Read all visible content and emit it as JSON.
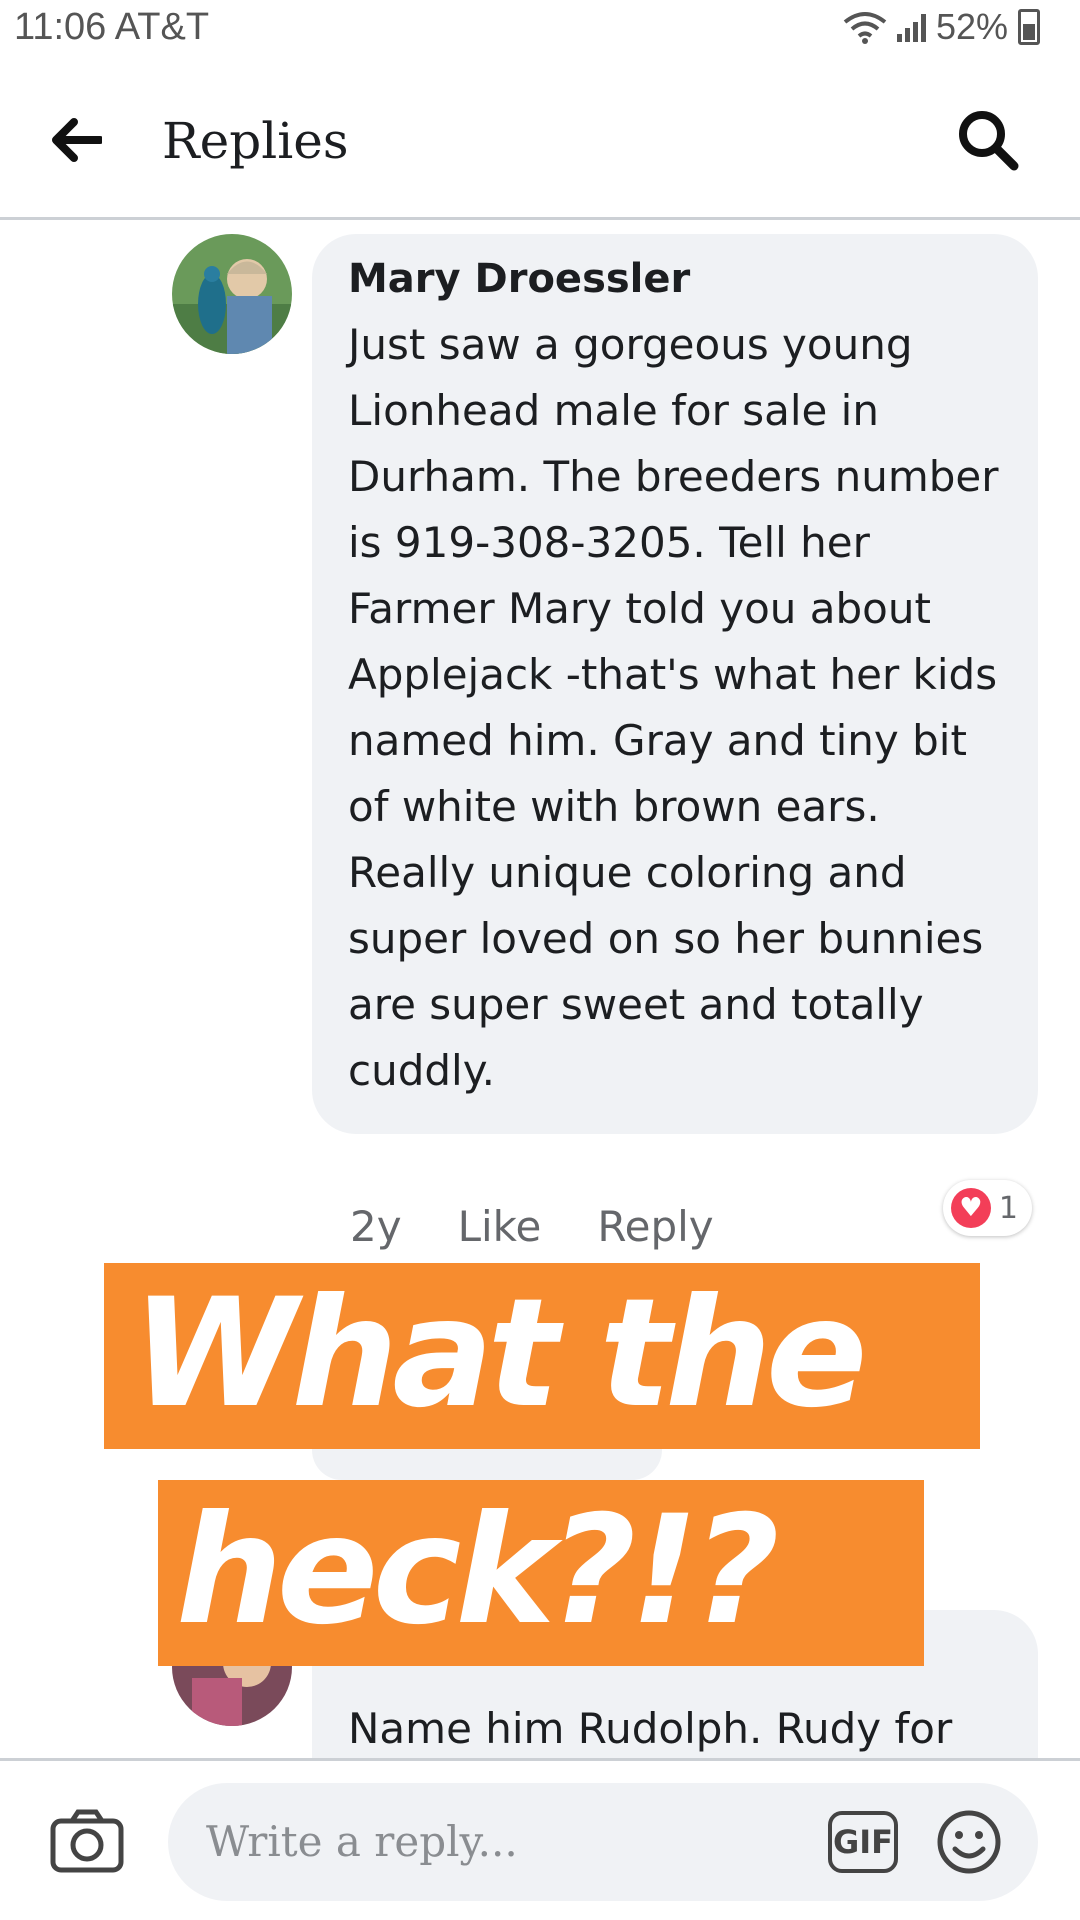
{
  "status_bar": {
    "time_carrier": "11:06 AT&T",
    "battery": "52%"
  },
  "header": {
    "title": "Replies"
  },
  "comment_main": {
    "author": "Mary Droessler",
    "text": "Just saw a gorgeous young Lionhead male for sale in Durham. The breeders number is 919-308-3205. Tell her Farmer Mary told you about Applejack -that's what her kids named him. Gray and tiny bit of white with brown ears. Really unique coloring and super loved on so her bunnies are super sweet and totally cuddly.",
    "time": "2y",
    "like_label": "Like",
    "reply_label": "Reply",
    "reaction_count": "1"
  },
  "comment_second": {
    "text": "Name him Rudolph. Rudy for"
  },
  "overlay": {
    "line1": "What the",
    "line2": "heck?!?"
  },
  "composer": {
    "placeholder": "Write a reply...",
    "gif_label": "GIF"
  },
  "colors": {
    "overlay_orange": "#f78c2f",
    "bubble_gray": "#f0f2f5",
    "reaction_red": "#f33e58"
  }
}
